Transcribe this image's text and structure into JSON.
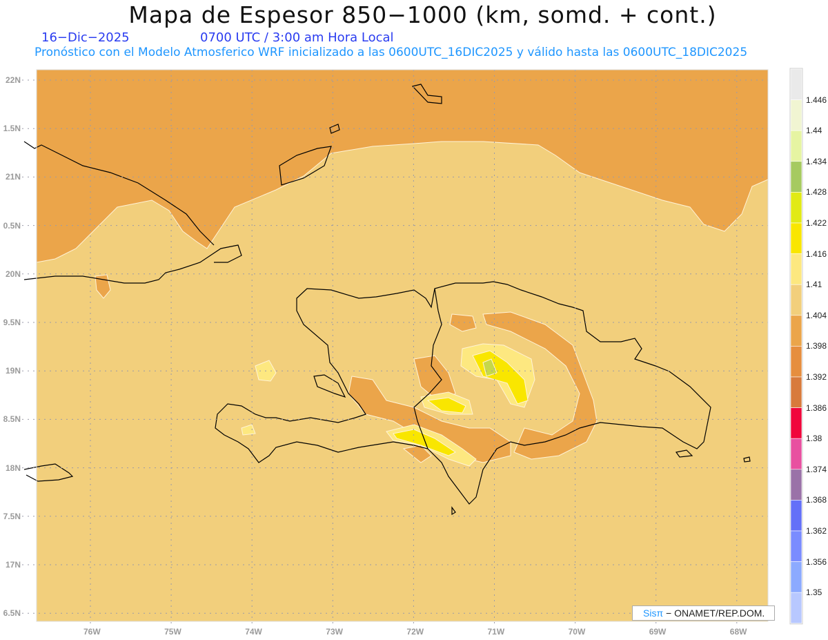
{
  "header": {
    "title": "Mapa de Espesor 850−1000 (km, somd. + cont.)",
    "date": "16−Dic−2025",
    "time": "0700 UTC / 3:00 am Hora Local",
    "subtitle": "Pronóstico con el Modelo Atmosferico WRF inicializado a las 0600UTC_16DIC2025 y válido hasta las  0600UTC_18DIC2025"
  },
  "map": {
    "lat_labels": [
      "22N",
      "1.5N",
      "21N",
      "0.5N",
      "20N",
      "9.5N",
      "19N",
      "8.5N",
      "18N",
      "7.5N",
      "17N",
      "6.5N"
    ],
    "lon_labels": [
      "76W",
      "75W",
      "74W",
      "73W",
      "72W",
      "71W",
      "70W",
      "69W",
      "68W"
    ],
    "grid": "dotted"
  },
  "colorbar": {
    "labels": [
      "1.446",
      "1.44",
      "1.434",
      "1.428",
      "1.422",
      "1.416",
      "1.41",
      "1.404",
      "1.398",
      "1.392",
      "1.386",
      "1.38",
      "1.374",
      "1.368",
      "1.362",
      "1.356",
      "1.35"
    ],
    "colors": [
      "#eaeaea",
      "#f1f5d2",
      "#e6f4a2",
      "#a6ca60",
      "#e1ea15",
      "#f9e600",
      "#fde880",
      "#f2cf7c",
      "#eba54a",
      "#e68e3e",
      "#d87a3c",
      "#f0063c",
      "#e850a0",
      "#9a72a8",
      "#6470f8",
      "#7a8cff",
      "#8caaff",
      "#b8c8ff"
    ]
  },
  "credit": {
    "brand": "Sisπ",
    "text": "− ONAMET/REP.DOM."
  }
}
